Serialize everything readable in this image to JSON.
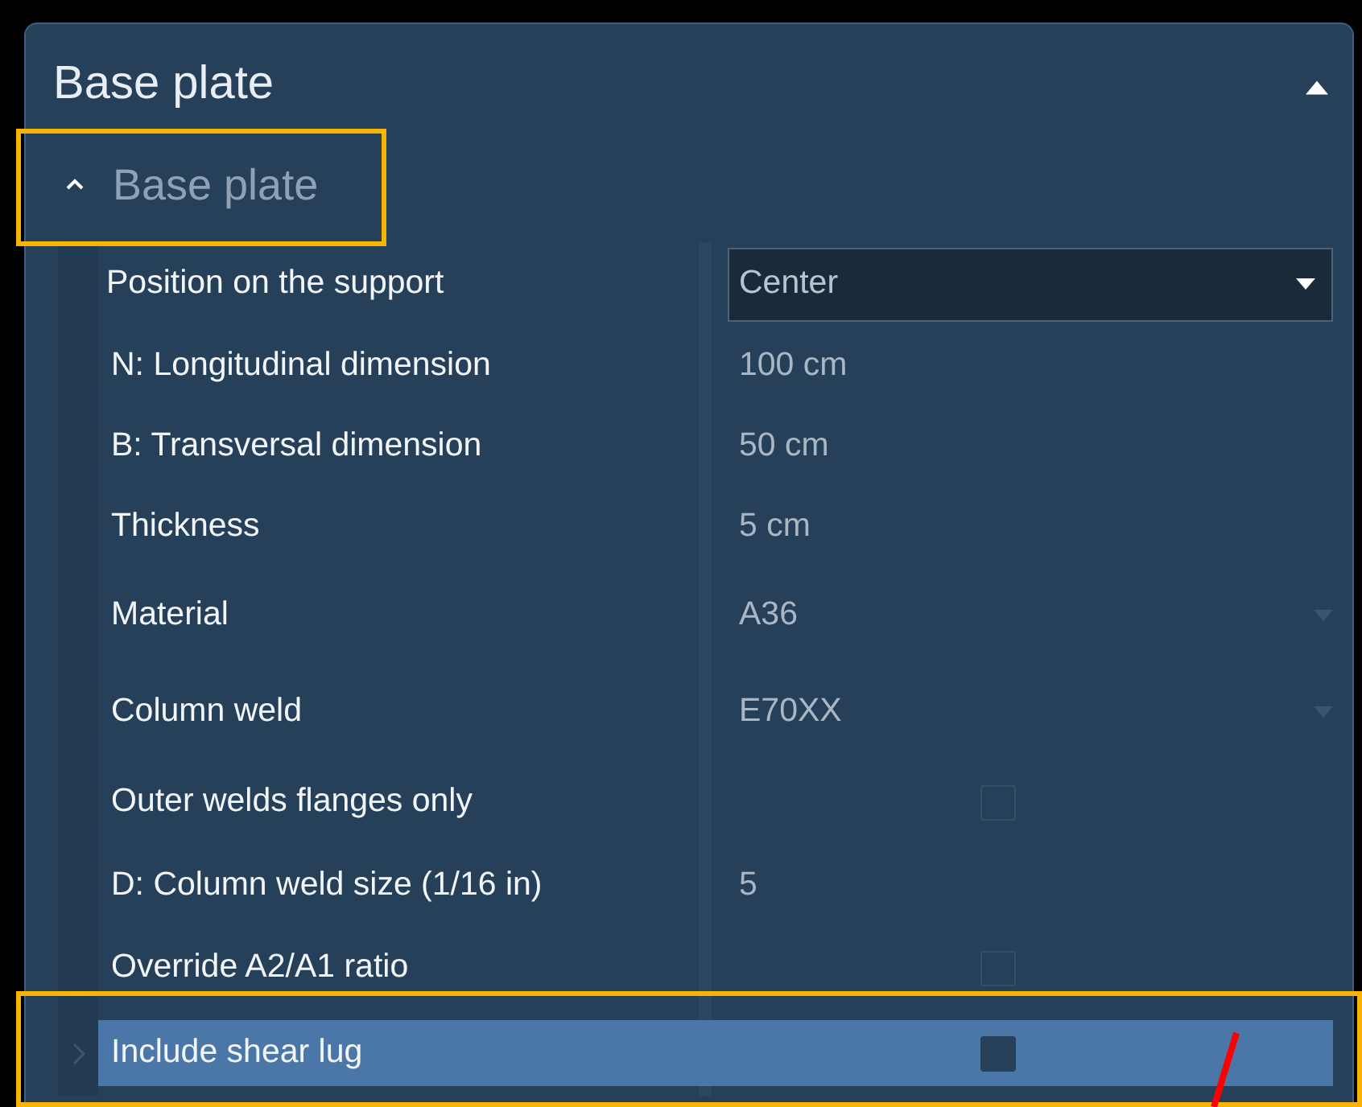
{
  "panel": {
    "title": "Base plate",
    "expanded": true
  },
  "group": {
    "title": "Base plate",
    "expanded": true
  },
  "rows": [
    {
      "kind": "dropdown",
      "label": "Position on the support",
      "value": "Center",
      "selected": false
    },
    {
      "kind": "text",
      "label": "N: Longitudinal dimension",
      "value": "100 cm",
      "selected": false
    },
    {
      "kind": "text",
      "label": "B: Transversal dimension",
      "value": "50 cm",
      "selected": false
    },
    {
      "kind": "text",
      "label": "Thickness",
      "value": "5 cm",
      "selected": false
    },
    {
      "kind": "combo",
      "label": "Material",
      "value": "A36",
      "selected": false
    },
    {
      "kind": "combo",
      "label": "Column weld",
      "value": "E70XX",
      "selected": false
    },
    {
      "kind": "checkbox",
      "label": "Outer welds flanges only",
      "checked": false,
      "selected": false
    },
    {
      "kind": "text",
      "label": "D: Column weld size (1/16 in)",
      "value": "5",
      "selected": false
    },
    {
      "kind": "checkbox",
      "label": "Override A2/A1 ratio",
      "checked": false,
      "selected": false
    },
    {
      "kind": "checkbox",
      "label": "Include shear lug",
      "checked": false,
      "selected": true
    }
  ]
}
